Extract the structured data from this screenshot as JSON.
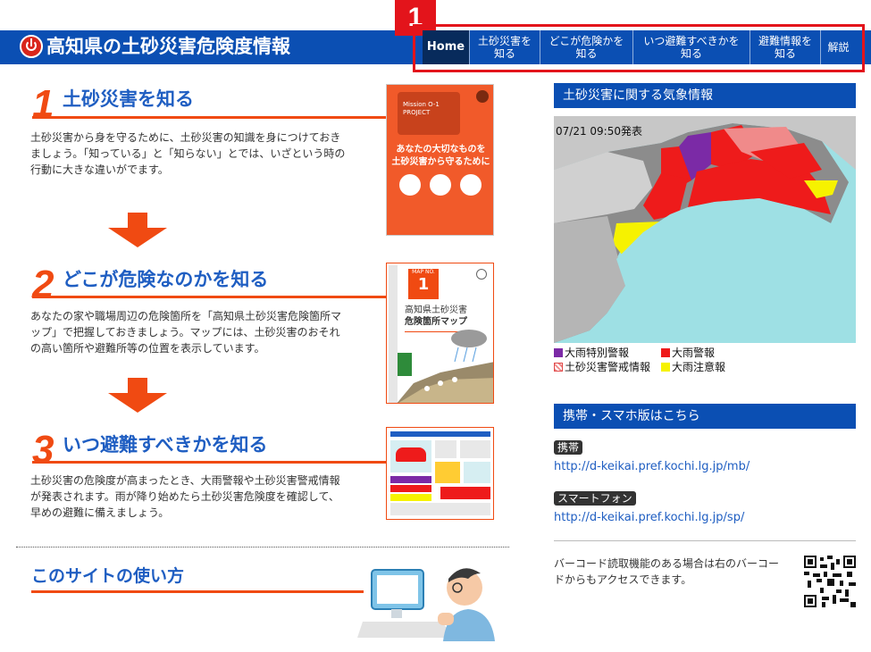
{
  "header": {
    "title": "高知県の土砂災害危険度情報",
    "nav": [
      {
        "label": "Home"
      },
      {
        "label": "土砂災害を\n知る"
      },
      {
        "label": "どこが危険かを\n知る"
      },
      {
        "label": "いつ避難すべきかを\n知る"
      },
      {
        "label": "避難情報を\n知る"
      },
      {
        "label": "解説"
      }
    ],
    "highlight_label": "1"
  },
  "sections": [
    {
      "number": "1",
      "title": "土砂災害を知る",
      "body": "土砂災害から身を守るために、土砂災害の知識を身につけておきましょう。「知っている」と「知らない」とでは、いざという時の行動に大きな違いがでます。"
    },
    {
      "number": "2",
      "title": "どこが危険なのかを知る",
      "body": "あなたの家や職場周辺の危険箇所を「高知県土砂災害危険箇所マップ」で把握しておきましょう。マップには、土砂災害のおそれの高い箇所や避難所等の位置を表示しています。"
    },
    {
      "number": "3",
      "title": "いつ避難すべきかを知る",
      "body": "土砂災害の危険度が高まったとき、大雨警報や土砂災害警戒情報が発表されます。雨が降り始めたら土砂災害危険度を確認して、早めの避難に備えましょう。"
    }
  ],
  "usage": {
    "title": "このサイトの使い方"
  },
  "thumb1": {
    "top_text": "Mission O-1 PROJECT",
    "line1": "あなたの大切なものを",
    "line2": "土砂災害から守るために"
  },
  "thumb2": {
    "map_no": "MAP NO.",
    "num": "1",
    "line1": "高知県土砂災害",
    "line2": "危険箇所マップ"
  },
  "weather": {
    "heading": "土砂災害に関する気象情報",
    "timestamp": "07/21 09:50発表",
    "legend": [
      {
        "label": "大雨特別警報",
        "color": "#7b2aa6"
      },
      {
        "label": "大雨警報",
        "color": "#ee1b1b"
      },
      {
        "label": "土砂災害警戒情報",
        "color": "#f08a8a"
      },
      {
        "label": "大雨注意報",
        "color": "#f6f200"
      }
    ]
  },
  "mobile": {
    "heading": "携帯・スマホ版はこちら",
    "keitai_label": "携帯",
    "keitai_url": "http://d-keikai.pref.kochi.lg.jp/mb/",
    "smartphone_label": "スマートフォン",
    "smartphone_url": "http://d-keikai.pref.kochi.lg.jp/sp/",
    "qr_text": "バーコード読取機能のある場合は右のバーコードからもアクセスできます。"
  }
}
